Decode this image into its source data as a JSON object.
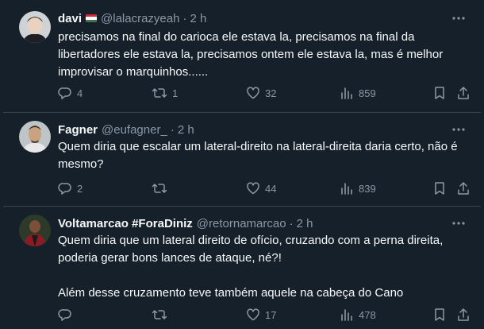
{
  "colors": {
    "background": "#15202b",
    "divider": "#38444d",
    "text": "#f7f9f9",
    "muted": "#8b98a5"
  },
  "tweets": [
    {
      "name": "davi",
      "flag": "hungary-flag-emoji",
      "handle": "@lalacrazyeah",
      "separator": "·",
      "time": "2 h",
      "text": "precisamos na final do carioca ele estava la, precisamos na final da libertadores ele estava la, precisamos ontem ele estava la, mas é melhor improvisar o marquinhos......",
      "replies": "4",
      "retweets": "1",
      "likes": "32",
      "views": "859"
    },
    {
      "name": "Fagner",
      "handle": "@eufagner_",
      "separator": "·",
      "time": "2 h",
      "text": "Quem diria que escalar um lateral-direito na lateral-direita daria certo, não é mesmo?",
      "replies": "2",
      "retweets": "",
      "likes": "44",
      "views": "839"
    },
    {
      "name": "Voltamarcao #ForaDiniz",
      "handle": "@retornamarcao",
      "separator": "·",
      "time": "2 h",
      "text": "Quem diria que um lateral direito de ofício, cruzando com a perna direita, poderia gerar bons lances de ataque, né?!\n\nAlém desse cruzamento teve também aquele na cabeça do Cano",
      "replies": "",
      "retweets": "",
      "likes": "17",
      "views": "478"
    }
  ]
}
